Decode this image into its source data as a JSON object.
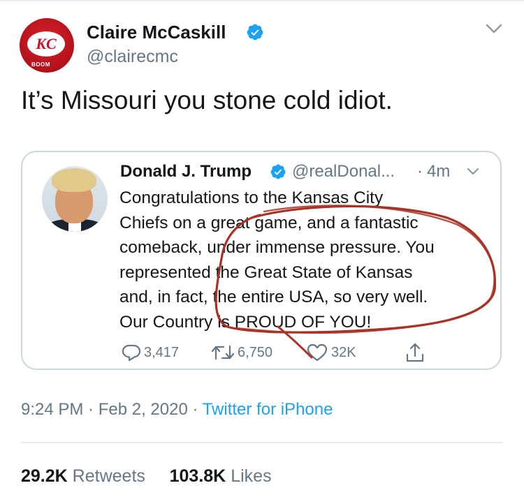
{
  "tweet": {
    "author_name": "Claire McCaskill",
    "author_handle": "@clairecmc",
    "avatar_text": "BOOM",
    "text": "It’s Missouri you stone cold idiot.",
    "timestamp": "9:24 PM · Feb 2, 2020 · ",
    "source": "Twitter for iPhone",
    "retweets_count": "29.2K",
    "retweets_label": "Retweets",
    "likes_count": "103.8K",
    "likes_label": "Likes"
  },
  "quoted_tweet": {
    "author_name": "Donald J. Trump",
    "author_handle": "@realDonal...",
    "separator": "·",
    "time": "4m",
    "lines": [
      "Congratulations to the Kansas City",
      "Chiefs on a great game, and a fantastic",
      "comeback, under immense pressure. You",
      "represented the Great State of Kansas",
      "and, in fact, the entire USA, so very well.",
      "Our Country is PROUD OF YOU!"
    ],
    "reply_count": "3,417",
    "retweet_count": "6,750",
    "like_count": "32K"
  },
  "icons": {
    "verified": "verified-badge-icon",
    "caret": "chevron-down-icon",
    "reply": "reply-icon",
    "retweet": "retweet-icon",
    "like": "heart-icon",
    "share": "share-icon"
  },
  "colors": {
    "link": "#1da1f2",
    "muted": "#657786",
    "verified": "#1da1f2",
    "annotation": "#a83226"
  }
}
